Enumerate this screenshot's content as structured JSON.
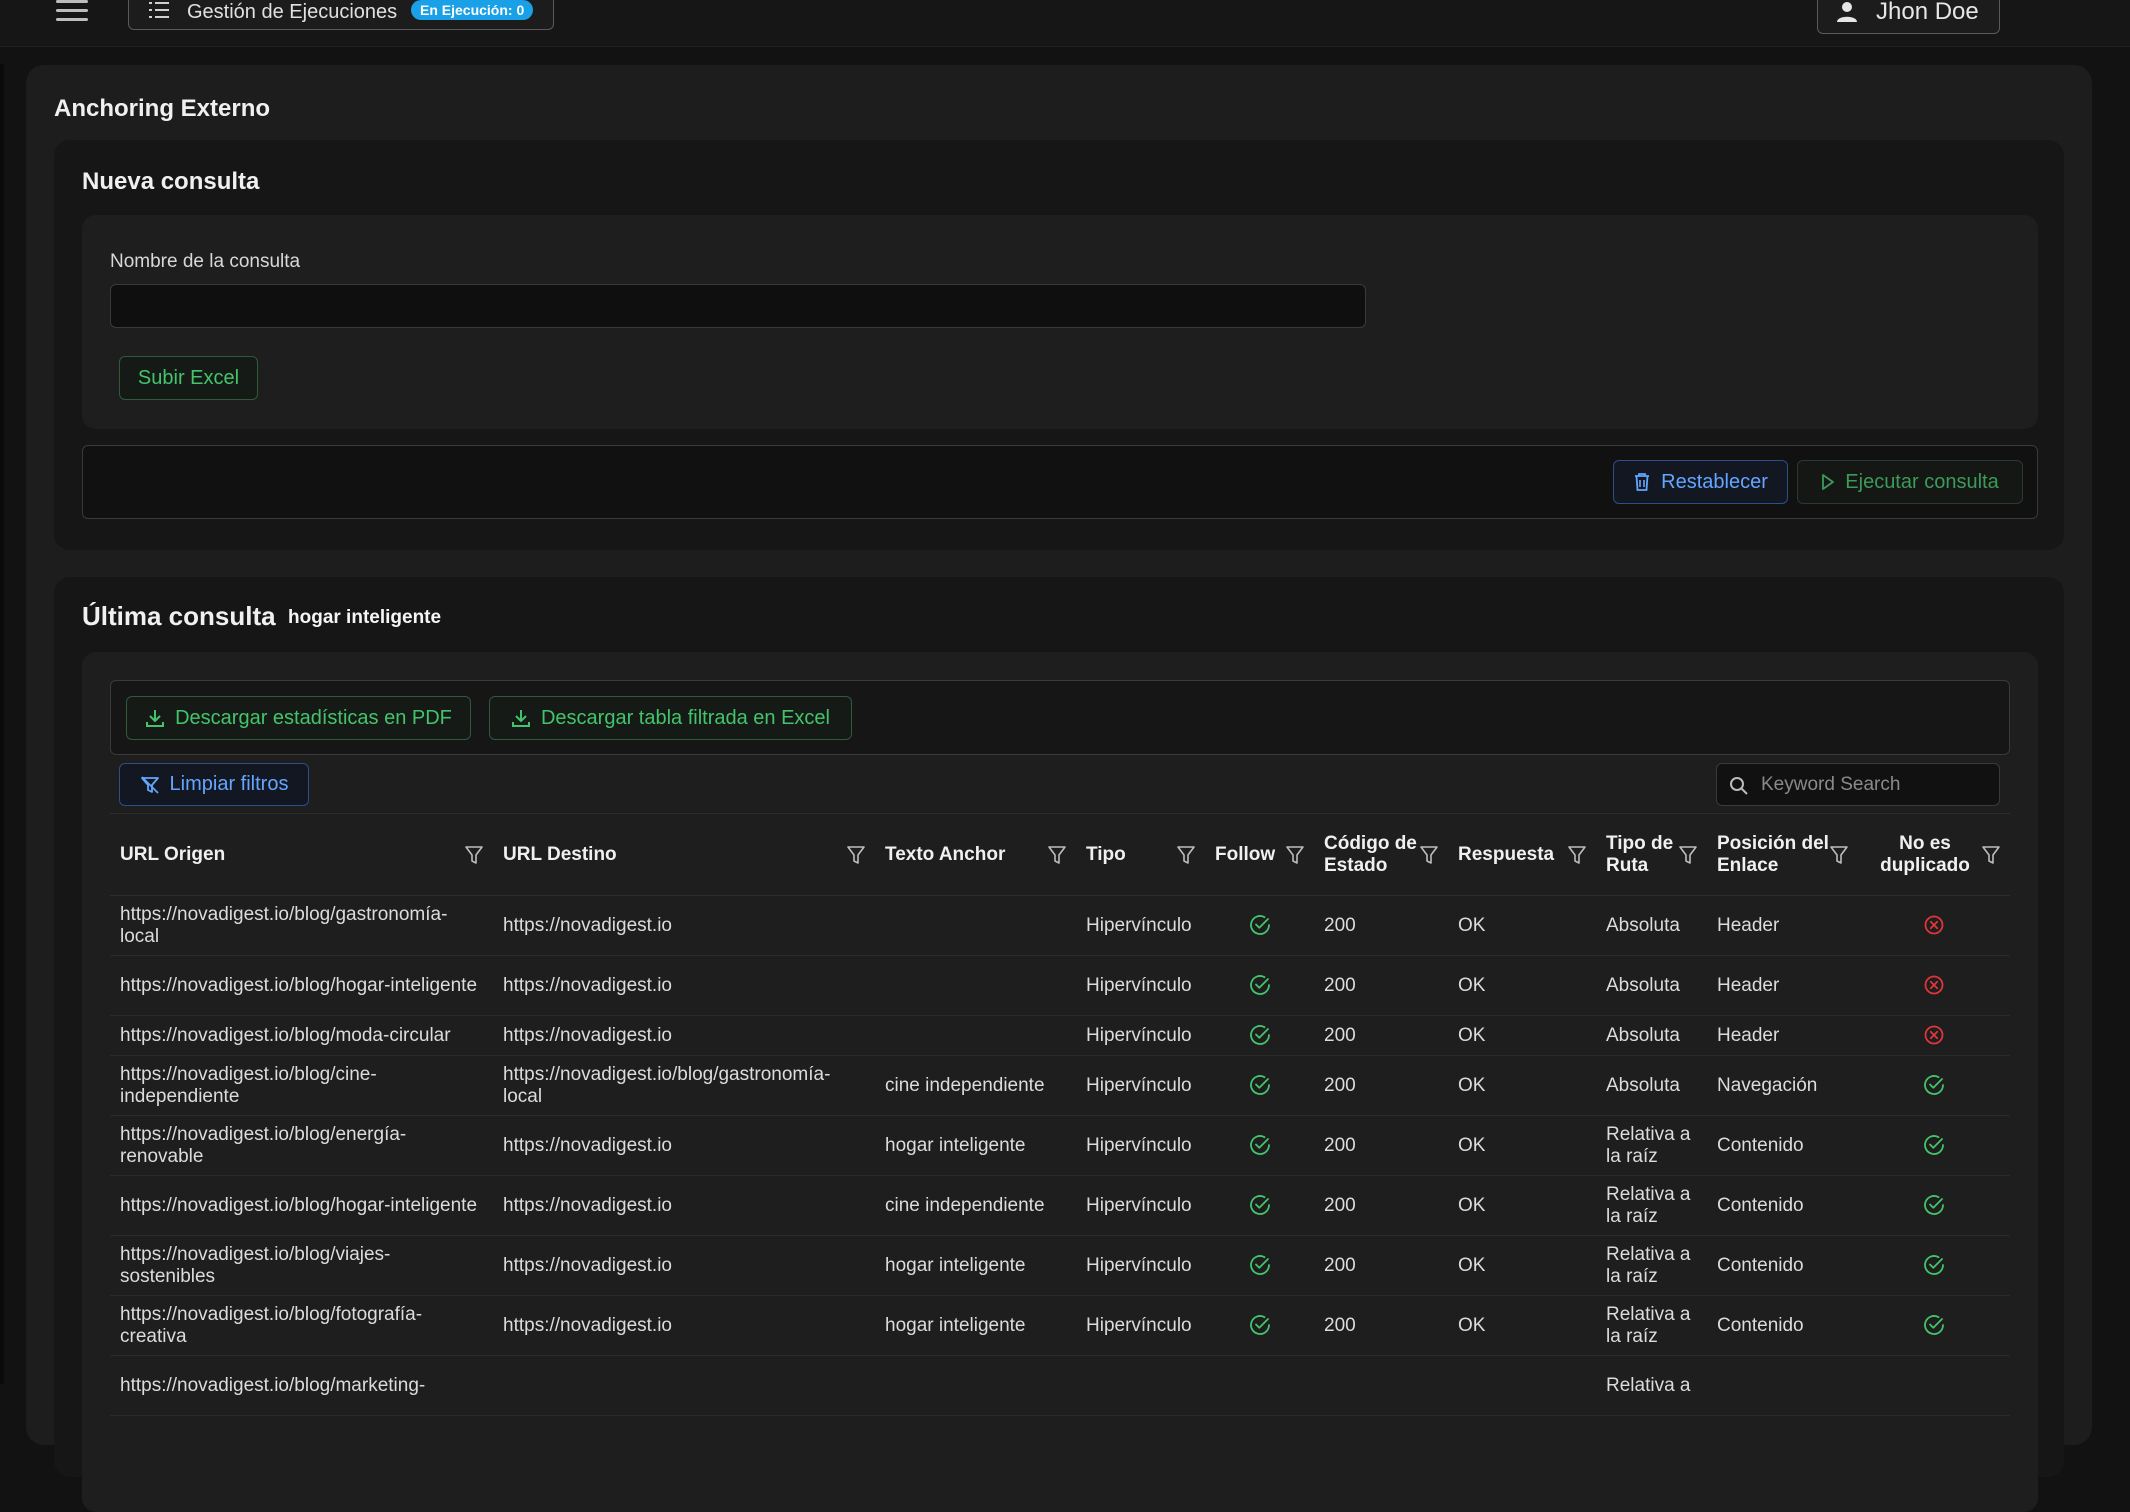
{
  "header": {
    "exec_label": "Gestión de Ejecuciones",
    "exec_badge": "En Ejecución: 0",
    "user_name": "Jhon Doe"
  },
  "page_title": "Anchoring Externo",
  "new_query": {
    "title": "Nueva consulta",
    "name_label": "Nombre de la consulta",
    "name_value": "",
    "upload_label": "Subir Excel",
    "reset_label": "Restablecer",
    "run_label": "Ejecutar consulta"
  },
  "last_query": {
    "title": "Última consulta",
    "name": "hogar inteligente",
    "pdf_label": "Descargar estadísticas en PDF",
    "excel_label": "Descargar tabla filtrada en Excel",
    "clear_filters_label": "Limpiar filtros",
    "search_placeholder": "Keyword Search"
  },
  "table": {
    "headers": [
      "URL Origen",
      "URL Destino",
      "Texto Anchor",
      "Tipo",
      "Follow",
      "Código de Estado",
      "Respuesta",
      "Tipo de Ruta",
      "Posición del Enlace",
      "No es duplicado"
    ],
    "rows": [
      {
        "origen": "https://novadigest.io/blog/gastronomía-local",
        "destino": "https://novadigest.io",
        "anchor": "",
        "tipo": "Hipervínculo",
        "follow": "check",
        "codigo": "200",
        "respuesta": "OK",
        "ruta": "Absoluta",
        "posicion": "Header",
        "dup": "x"
      },
      {
        "origen": "https://novadigest.io/blog/hogar-inteligente",
        "destino": "https://novadigest.io",
        "anchor": "",
        "tipo": "Hipervínculo",
        "follow": "check",
        "codigo": "200",
        "respuesta": "OK",
        "ruta": "Absoluta",
        "posicion": "Header",
        "dup": "x"
      },
      {
        "origen": "https://novadigest.io/blog/moda-circular",
        "destino": "https://novadigest.io",
        "anchor": "",
        "tipo": "Hipervínculo",
        "follow": "check",
        "codigo": "200",
        "respuesta": "OK",
        "ruta": "Absoluta",
        "posicion": "Header",
        "dup": "x"
      },
      {
        "origen": "https://novadigest.io/blog/cine-independiente",
        "destino": "https://novadigest.io/blog/gastronomía-local",
        "anchor": "cine independiente",
        "tipo": "Hipervínculo",
        "follow": "check",
        "codigo": "200",
        "respuesta": "OK",
        "ruta": "Absoluta",
        "posicion": "Navegación",
        "dup": "check"
      },
      {
        "origen": "https://novadigest.io/blog/energía-renovable",
        "destino": "https://novadigest.io",
        "anchor": "hogar inteligente",
        "tipo": "Hipervínculo",
        "follow": "check",
        "codigo": "200",
        "respuesta": "OK",
        "ruta": "Relativa a la raíz",
        "posicion": "Contenido",
        "dup": "check"
      },
      {
        "origen": "https://novadigest.io/blog/hogar-inteligente",
        "destino": "https://novadigest.io",
        "anchor": "cine independiente",
        "tipo": "Hipervínculo",
        "follow": "check",
        "codigo": "200",
        "respuesta": "OK",
        "ruta": "Relativa a la raíz",
        "posicion": "Contenido",
        "dup": "check"
      },
      {
        "origen": "https://novadigest.io/blog/viajes-sostenibles",
        "destino": "https://novadigest.io",
        "anchor": "hogar inteligente",
        "tipo": "Hipervínculo",
        "follow": "check",
        "codigo": "200",
        "respuesta": "OK",
        "ruta": "Relativa a la raíz",
        "posicion": "Contenido",
        "dup": "check"
      },
      {
        "origen": "https://novadigest.io/blog/fotografía-creativa",
        "destino": "https://novadigest.io",
        "anchor": "hogar inteligente",
        "tipo": "Hipervínculo",
        "follow": "check",
        "codigo": "200",
        "respuesta": "OK",
        "ruta": "Relativa a la raíz",
        "posicion": "Contenido",
        "dup": "check"
      },
      {
        "origen": "https://novadigest.io/blog/marketing-",
        "destino": "",
        "anchor": "",
        "tipo": "",
        "follow": "",
        "codigo": "",
        "respuesta": "",
        "ruta": "Relativa a",
        "posicion": "",
        "dup": ""
      }
    ]
  },
  "colors": {
    "accent_green": "#43c46b",
    "accent_blue": "#63a6ff",
    "error_red": "#e0353b",
    "badge_blue": "#1aa0e6"
  }
}
